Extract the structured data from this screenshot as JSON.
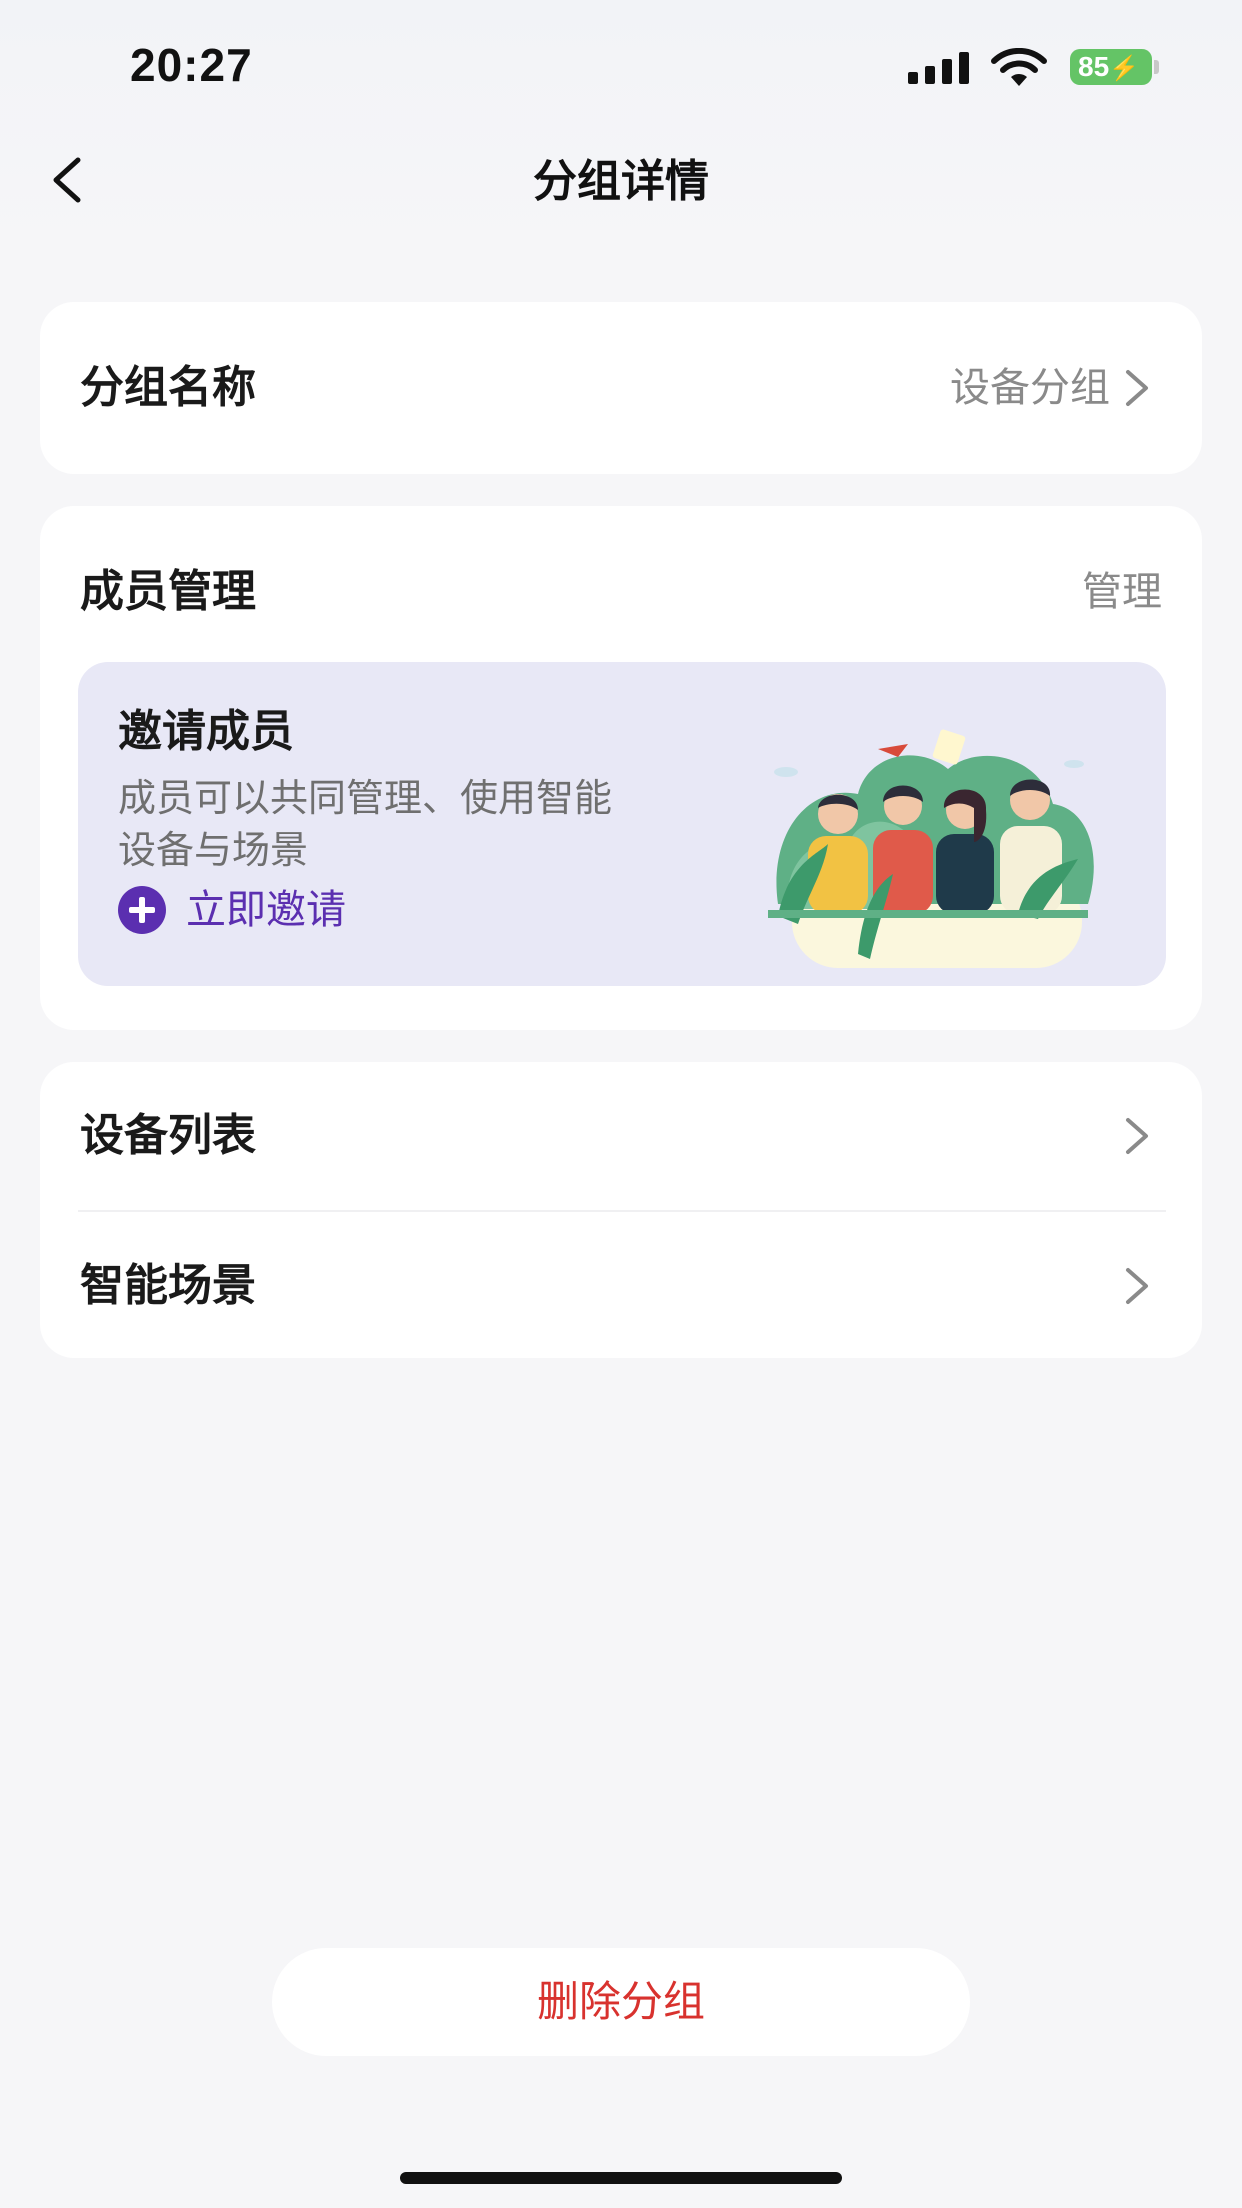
{
  "status_bar": {
    "time": "20:27",
    "battery": "85",
    "battery_charging_glyph": "⚡"
  },
  "nav": {
    "title": "分组详情",
    "back_icon": "chevron-left-icon"
  },
  "group_name": {
    "label": "分组名称",
    "value": "设备分组"
  },
  "members": {
    "label": "成员管理",
    "manage_label": "管理",
    "invite": {
      "title": "邀请成员",
      "description": "成员可以共同管理、使用智能设备与场景",
      "action_label": "立即邀请",
      "action_icon": "plus-circle-icon",
      "accent_color": "#5b2fb0"
    }
  },
  "list": {
    "items": [
      {
        "label": "设备列表"
      },
      {
        "label": "智能场景"
      }
    ]
  },
  "delete_button": {
    "label": "删除分组",
    "color": "#d8322e"
  }
}
